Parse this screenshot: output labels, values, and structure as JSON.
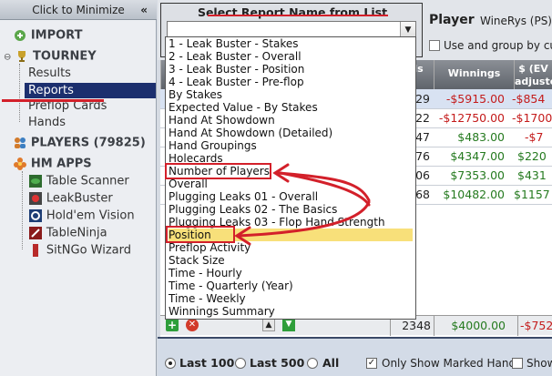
{
  "sidebar": {
    "minimize_label": "Click to Minimize",
    "minimize_chevron": "«",
    "sections": {
      "import": "IMPORT",
      "tourney": "TOURNEY",
      "players": "PLAYERS (79825)",
      "hm_apps": "HM APPS"
    },
    "tourney_items": [
      "Results",
      "Reports",
      "Preflop Cards",
      "Hands"
    ],
    "apps": [
      "Table Scanner",
      "LeakBuster",
      "Hold'em Vision",
      "TableNinja",
      "SitNGo Wizard"
    ]
  },
  "report_selector": {
    "title": "Select Report Name from List",
    "current_value": "",
    "options": [
      "1 - Leak Buster - Stakes",
      "2 - Leak Buster - Overall",
      "3 - Leak Buster - Position",
      "4 - Leak Buster - Pre-flop",
      "By Stakes",
      "Expected Value - By Stakes",
      "Hand At Showdown",
      "Hand At Showdown (Detailed)",
      "Hand Groupings",
      "Holecards",
      "Number of Players",
      "Overall",
      "Plugging Leaks 01 - Overall",
      "Plugging Leaks 02 - The Basics",
      "Plugging Leaks 03 - Flop Hand Strength",
      "Position",
      "Preflop Activity",
      "Stack Size",
      "Time - Hourly",
      "Time - Quarterly (Year)",
      "Time - Weekly",
      "Winnings Summary"
    ],
    "highlighted": "Position"
  },
  "player": {
    "label": "Player",
    "value": "WineRys (PS)",
    "group_label": "Use and group by cu"
  },
  "grid": {
    "headers": {
      "hands": "ds",
      "winnings": "Winnings",
      "ev": "$ (EV adjuste"
    },
    "rows": [
      {
        "hands": "29",
        "winnings": "-$5915.00",
        "ev": "-$854"
      },
      {
        "hands": "22",
        "winnings": "-$12750.00",
        "ev": "-$1700"
      },
      {
        "hands": "47",
        "winnings": "$483.00",
        "ev": "-$7"
      },
      {
        "hands": "76",
        "winnings": "$4347.00",
        "ev": "$220"
      },
      {
        "hands": "06",
        "winnings": "$7353.00",
        "ev": "$431"
      },
      {
        "hands": "68",
        "winnings": "$10482.00",
        "ev": "$1157"
      }
    ],
    "totals": {
      "hands": "2348",
      "winnings": "$4000.00",
      "ev": "-$752"
    }
  },
  "bottom_bar": {
    "last100": "Last 100",
    "last500": "Last 500",
    "all": "All",
    "marked_hands": "Only Show Marked Hands",
    "show": "Show"
  },
  "colors": {
    "accent_red": "#d3202a",
    "highlight": "#f8e07a",
    "positive": "#257a1f",
    "negative": "#c41b1b"
  }
}
